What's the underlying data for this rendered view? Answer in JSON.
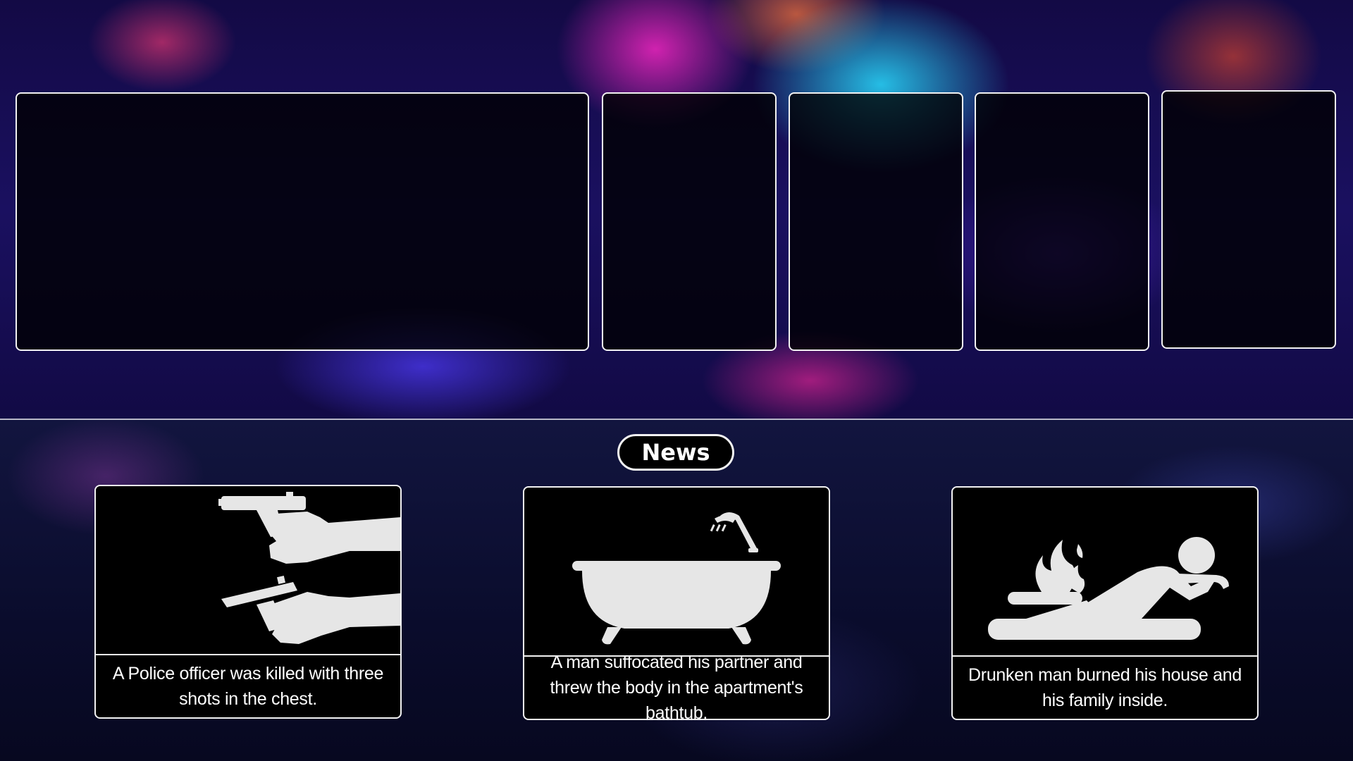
{
  "header": {
    "badge_label": "News"
  },
  "slots": [
    {
      "name": "slot-1"
    },
    {
      "name": "slot-2"
    },
    {
      "name": "slot-3"
    },
    {
      "name": "slot-4"
    },
    {
      "name": "slot-5"
    }
  ],
  "news": [
    {
      "icon": "pistols-icon",
      "caption": "A Police officer was killed with three shots in the chest."
    },
    {
      "icon": "bathtub-icon",
      "caption": "A man suffocated his partner and threw the body in the apartment's bathtub."
    },
    {
      "icon": "burning-man-icon",
      "caption": "Drunken man burned his house and his family inside."
    }
  ],
  "colors": {
    "border": "#f2f2f2",
    "icon": "#e6e6e6",
    "panel_bg": "#000000"
  }
}
